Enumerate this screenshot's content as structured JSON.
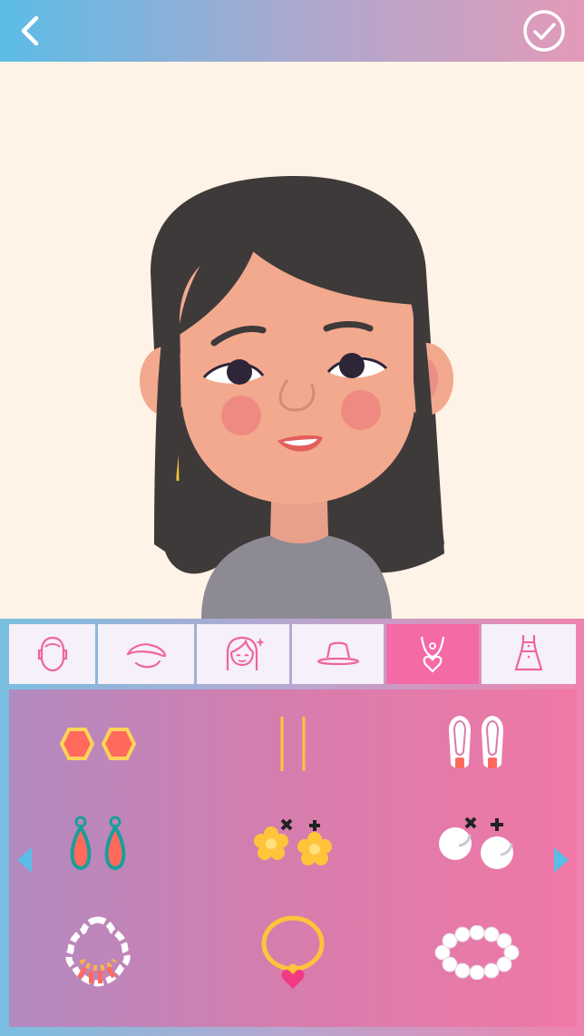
{
  "header": {
    "back_icon": "chevron-left-icon",
    "confirm_icon": "check-circle-icon"
  },
  "colors": {
    "header_gradient": [
      "#5cbce6",
      "#a9a9cf",
      "#e39ab8"
    ],
    "active_tab": "#f46aa6",
    "tab_bg": "#f5f0fa",
    "tab_icon_stroke": "#f063a0",
    "canvas_bg": "#fef3e6"
  },
  "avatar": {
    "hair": "#3e3a3a",
    "skin": "#f2a98e",
    "shirt": "#8d8a94",
    "cheeks": "#ee8a82"
  },
  "tabs": [
    {
      "icon": "face-shape-icon",
      "active": false
    },
    {
      "icon": "eyebrow-icon",
      "active": false
    },
    {
      "icon": "hairstyle-icon",
      "active": false
    },
    {
      "icon": "hat-icon",
      "active": false
    },
    {
      "icon": "necklace-icon",
      "active": true
    },
    {
      "icon": "dress-icon",
      "active": false
    }
  ],
  "accessories": [
    "hexagon-earrings",
    "bar-earrings",
    "drop-earrings",
    "teardrop-earrings",
    "flower-earrings",
    "pearl-earrings",
    "beaded-necklace",
    "heart-pendant-necklace",
    "pearl-bracelet"
  ],
  "navigation": {
    "prev_icon": "arrow-left-icon",
    "next_icon": "arrow-right-icon"
  }
}
